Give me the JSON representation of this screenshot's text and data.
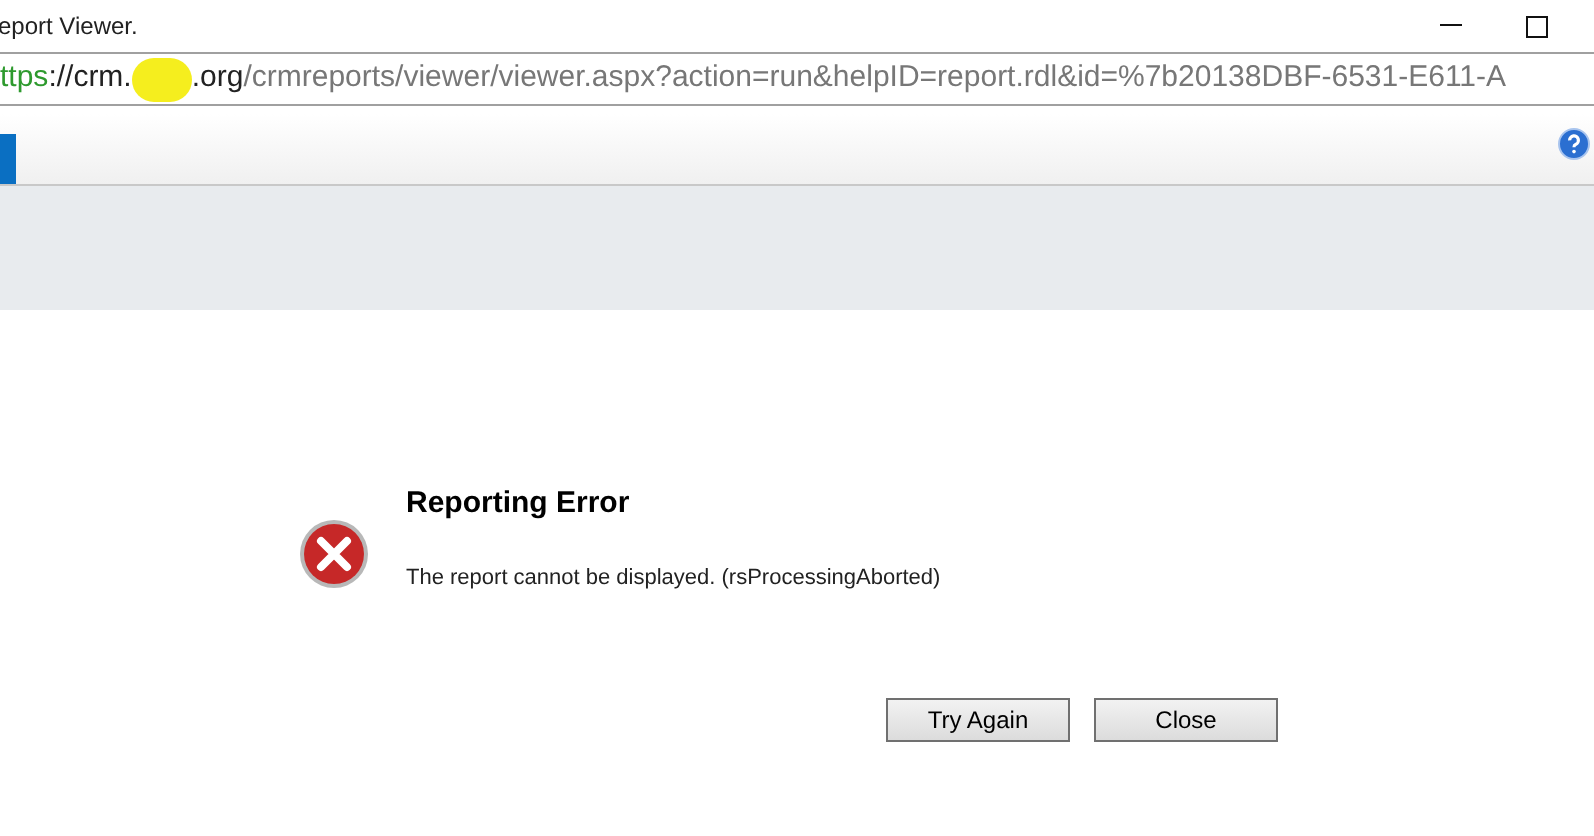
{
  "window": {
    "title": "eport Viewer."
  },
  "address_bar": {
    "url_parts": [
      {
        "kind": "scheme",
        "text": "ttps"
      },
      {
        "kind": "host",
        "text": "://crm."
      },
      {
        "kind": "redacted"
      },
      {
        "kind": "host",
        "text": ".org"
      },
      {
        "kind": "path",
        "text": "/crmreports/viewer/viewer.aspx?action=run&helpID=report.rdl&id=%7b20138DBF-6531-E611-A"
      }
    ]
  },
  "error": {
    "title": "Reporting Error",
    "message": "The report cannot be displayed. (rsProcessingAborted)"
  },
  "buttons": [
    "Try Again",
    "Close"
  ]
}
